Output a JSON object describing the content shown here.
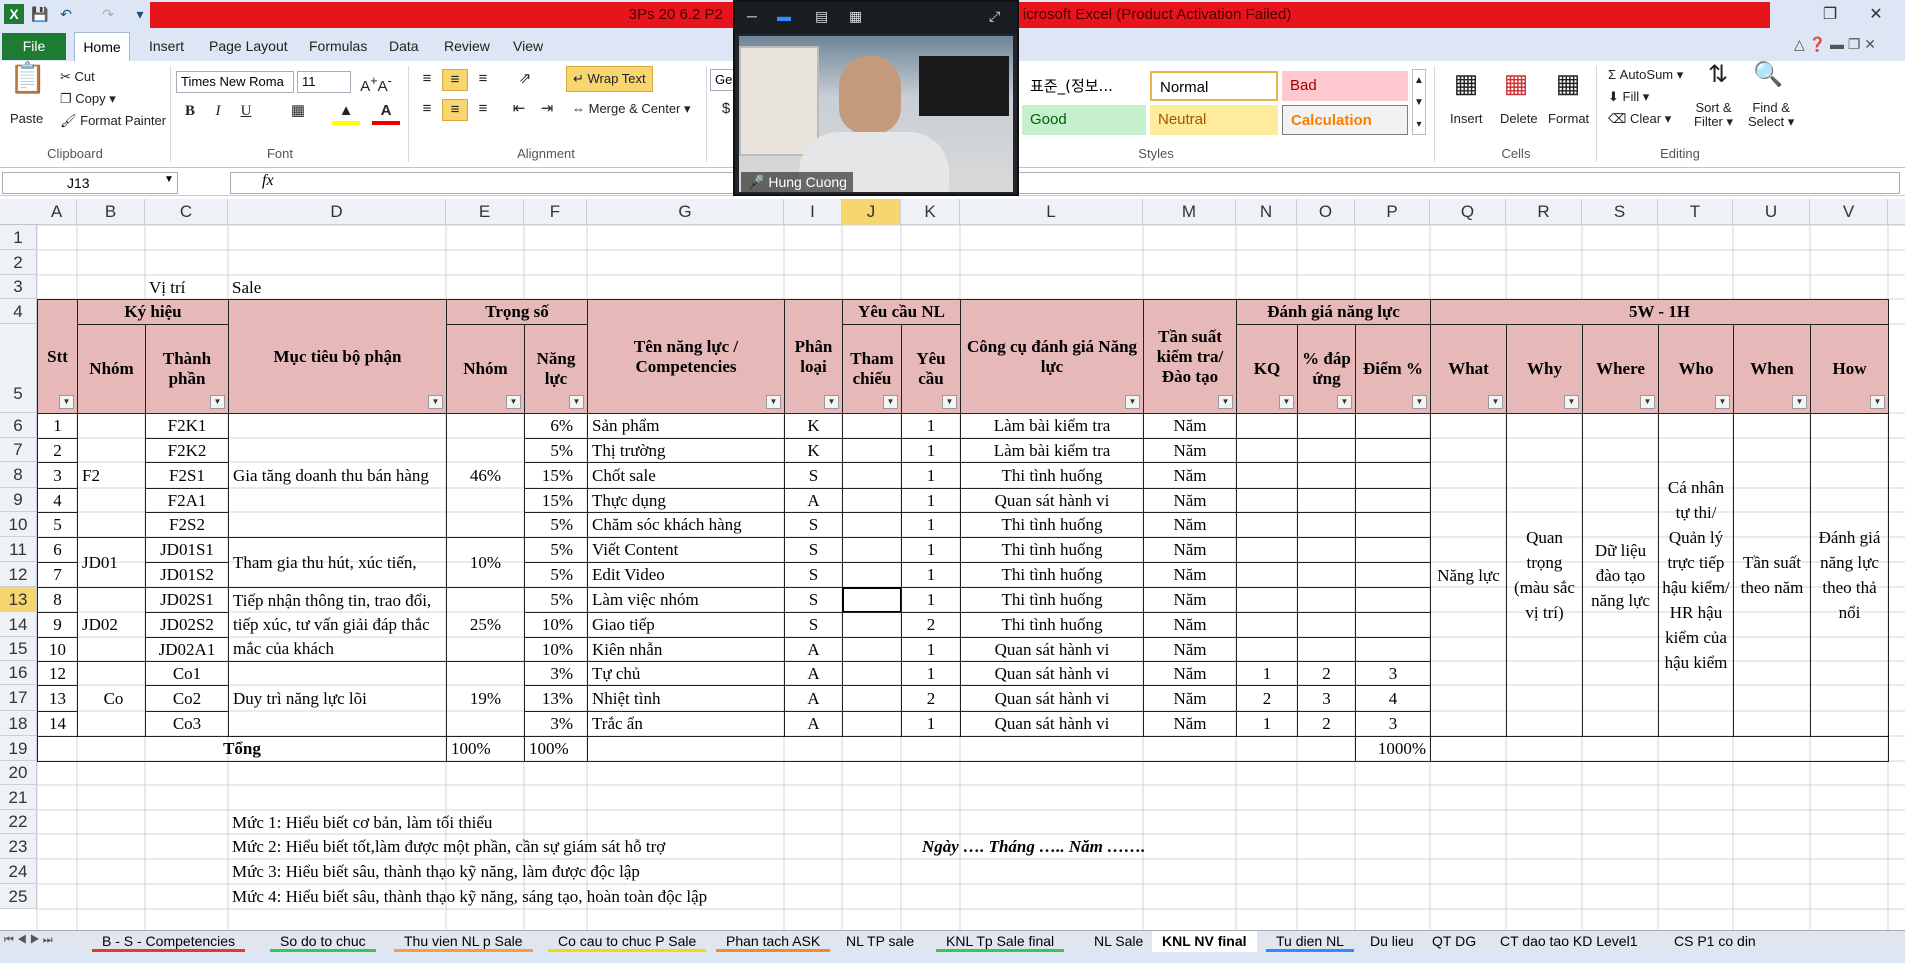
{
  "app": {
    "title": "3Ps 20 6.2 P2",
    "title_suffix": "icrosoft Excel (Product Activation Failed)"
  },
  "ribbon": {
    "tabs": [
      "File",
      "Home",
      "Insert",
      "Page Layout",
      "Formulas",
      "Data",
      "Review",
      "View"
    ],
    "clipboard": {
      "paste": "Paste",
      "cut": "Cut",
      "copy": "Copy",
      "format_painter": "Format Painter",
      "label": "Clipboard"
    },
    "font": {
      "name": "Times New Roma",
      "size": "11",
      "label": "Font"
    },
    "alignment": {
      "wrap_text": "Wrap Text",
      "merge": "Merge & Center",
      "label": "Alignment"
    },
    "number": {
      "format": "Ger"
    },
    "styles": {
      "label": "Styles",
      "items": [
        "표준_(정보...",
        "Normal",
        "Bad",
        "Good",
        "Neutral",
        "Calculation"
      ]
    },
    "cells": {
      "label": "Cells",
      "insert": "Insert",
      "delete": "Delete",
      "format": "Format"
    },
    "editing": {
      "label": "Editing",
      "autosum": "AutoSum",
      "fill": "Fill",
      "clear": "Clear",
      "sort": "Sort &",
      "filter": "Filter",
      "find": "Find &",
      "select": "Select"
    }
  },
  "namebox": "J13",
  "video": {
    "name": "Hung Cuong"
  },
  "columns": [
    "A",
    "B",
    "C",
    "D",
    "E",
    "F",
    "G",
    "I",
    "J",
    "K",
    "L",
    "M",
    "N",
    "O",
    "P",
    "Q",
    "R",
    "S",
    "T",
    "U",
    "V"
  ],
  "rows": [
    "1",
    "2",
    "3",
    "4",
    "5",
    "6",
    "7",
    "8",
    "9",
    "10",
    "11",
    "12",
    "13",
    "14",
    "15",
    "16",
    "17",
    "18",
    "19",
    "20",
    "21",
    "22",
    "23",
    "24",
    "25"
  ],
  "sheet": {
    "vitri_label": "Vị trí",
    "vitri_value": "Sale",
    "h_kyhieu": "Ký hiệu",
    "h_nhom": "Nhóm",
    "h_thanhphan": "Thành phần",
    "h_stt": "Stt",
    "h_muctieu": "Mục tiêu bộ phận",
    "h_trongso": "Trọng số",
    "h_ts_nhom": "Nhóm",
    "h_nangluc": "Năng lực",
    "h_tennl": "Tên năng lực / Competencies",
    "h_phanloai": "Phân loại",
    "h_yeucau_nl": "Yêu cầu NL",
    "h_thamchieu": "Tham chiếu",
    "h_yeucau": "Yêu cầu",
    "h_congcu": "Công cụ đánh giá Năng lực",
    "h_tansuat": "Tần suất kiểm tra/ Đào tạo",
    "h_danhgia": "Đánh giá năng lực",
    "h_kq": "KQ",
    "h_dapung": "% đáp ứng",
    "h_diem": "Điểm %",
    "h_5w": "5W - 1H",
    "h_what": "What",
    "h_why": "Why",
    "h_where": "Where",
    "h_who": "Who",
    "h_when": "When",
    "h_how": "How",
    "data": [
      {
        "stt": "1",
        "tp": "F2K1",
        "ts": "6%",
        "ten": "Sản phẩm",
        "pl": "K",
        "yc": "1",
        "cc": "Làm bài kiểm tra",
        "tsu": "Năm",
        "kq": "",
        "du": "",
        "d": ""
      },
      {
        "stt": "2",
        "tp": "F2K2",
        "ts": "5%",
        "ten": "Thị trường",
        "pl": "K",
        "yc": "1",
        "cc": "Làm bài kiểm tra",
        "tsu": "Năm",
        "kq": "",
        "du": "",
        "d": ""
      },
      {
        "stt": "3",
        "tp": "F2S1",
        "ts": "15%",
        "ten": "Chốt sale",
        "pl": "S",
        "yc": "1",
        "cc": "Thi tình huống",
        "tsu": "Năm",
        "kq": "",
        "du": "",
        "d": ""
      },
      {
        "stt": "4",
        "tp": "F2A1",
        "ts": "15%",
        "ten": "Thực dụng",
        "pl": "A",
        "yc": "1",
        "cc": "Quan sát hành vi",
        "tsu": "Năm",
        "kq": "",
        "du": "",
        "d": ""
      },
      {
        "stt": "5",
        "tp": "F2S2",
        "ts": "5%",
        "ten": "Chăm sóc khách hàng",
        "pl": "S",
        "yc": "1",
        "cc": "Thi tình huống",
        "tsu": "Năm",
        "kq": "",
        "du": "",
        "d": ""
      },
      {
        "stt": "6",
        "tp": "JD01S1",
        "ts": "5%",
        "ten": "Viết Content",
        "pl": "S",
        "yc": "1",
        "cc": "Thi tình huống",
        "tsu": "Năm",
        "kq": "",
        "du": "",
        "d": ""
      },
      {
        "stt": "7",
        "tp": "JD01S2",
        "ts": "5%",
        "ten": "Edit Video",
        "pl": "S",
        "yc": "1",
        "cc": "Thi tình huống",
        "tsu": "Năm",
        "kq": "",
        "du": "",
        "d": ""
      },
      {
        "stt": "8",
        "tp": "JD02S1",
        "ts": "5%",
        "ten": "Làm việc nhóm",
        "pl": "S",
        "yc": "1",
        "cc": "Thi tình huống",
        "tsu": "Năm",
        "kq": "",
        "du": "",
        "d": ""
      },
      {
        "stt": "9",
        "tp": "JD02S2",
        "ts": "10%",
        "ten": "Giao tiếp",
        "pl": "S",
        "yc": "2",
        "cc": "Thi tình huống",
        "tsu": "Năm",
        "kq": "",
        "du": "",
        "d": ""
      },
      {
        "stt": "10",
        "tp": "JD02A1",
        "ts": "10%",
        "ten": "Kiên nhẫn",
        "pl": "A",
        "yc": "1",
        "cc": "Quan sát hành vi",
        "tsu": "Năm",
        "kq": "",
        "du": "",
        "d": ""
      },
      {
        "stt": "12",
        "tp": "Co1",
        "ts": "3%",
        "ten": "Tự chủ",
        "pl": "A",
        "yc": "1",
        "cc": "Quan sát hành vi",
        "tsu": "Năm",
        "kq": "1",
        "du": "2",
        "d": "3"
      },
      {
        "stt": "13",
        "tp": "Co2",
        "ts": "13%",
        "ten": "Nhiệt tình",
        "pl": "A",
        "yc": "2",
        "cc": "Quan sát hành vi",
        "tsu": "Năm",
        "kq": "2",
        "du": "3",
        "d": "4"
      },
      {
        "stt": "14",
        "tp": "Co3",
        "ts": "3%",
        "ten": "Trắc ẩn",
        "pl": "A",
        "yc": "1",
        "cc": "Quan sát hành vi",
        "tsu": "Năm",
        "kq": "1",
        "du": "2",
        "d": "3"
      }
    ],
    "groups": {
      "f2": "F2",
      "jd01": "JD01",
      "jd02": "JD02",
      "co": "Co"
    },
    "goals": {
      "f2": "Gia tăng doanh thu bán hàng",
      "jd01": "Tham gia thu hút, xúc tiến,",
      "jd02": "Tiếp nhận thông tin, trao đổi, tiếp xúc, tư vấn giải đáp thắc mắc của khách",
      "co": "Duy trì năng lực lõi"
    },
    "weights": {
      "f2": "46%",
      "jd01": "10%",
      "jd02": "25%",
      "co": "19%"
    },
    "w5": {
      "what": "Năng lực",
      "why": "Quan trọng (màu sắc vị trí)",
      "where": "Dữ liệu đào tạo năng lực",
      "who": "Cá nhân tự thi/ Quản lý trực tiếp hậu kiểm/ HR hậu kiểm của hậu kiểm",
      "when": "Tần suất theo năm",
      "how": "Đánh giá năng lực theo thả nổi"
    },
    "total": {
      "label": "Tổng",
      "nhom": "100%",
      "nangluc": "100%",
      "diem": "1000%"
    },
    "levels": [
      "Mức 1: Hiểu biết cơ bản, làm tối thiểu",
      "Mức 2: Hiểu biết tốt,làm được một phần, cần sự giám sát hỗ trợ",
      "Mức 3: Hiểu biết sâu, thành thạo kỹ năng, làm được độc lập",
      "Mức 4: Hiểu biết sâu, thành thạo kỹ năng, sáng tạo, hoàn toàn độc lập"
    ],
    "date_line": "Ngày …. Tháng ….. Năm ……."
  },
  "sheet_tabs": [
    "B - S - Competencies",
    "So do to chuc",
    "Thu vien NL p Sale",
    "Co cau to chuc P Sale",
    "Phan tach ASK",
    "NL TP sale",
    "KNL Tp Sale final",
    "NL Sale",
    "KNL NV final",
    "Tu dien NL",
    "Du lieu",
    "QT DG",
    "CT dao tao KD Level1",
    "CS P1 co din"
  ],
  "active_tab": "KNL NV final",
  "colors": {
    "header_fill": "#e6b8b7",
    "excel_green": "#1e7b34",
    "title_red": "#e8141c"
  }
}
